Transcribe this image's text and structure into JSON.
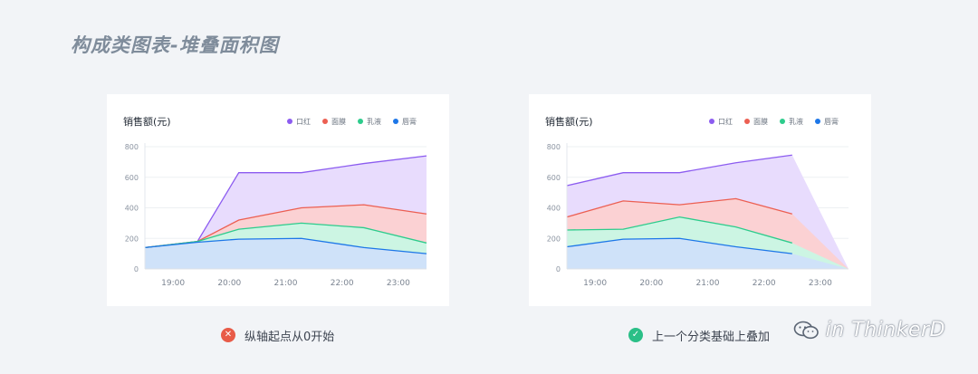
{
  "page": {
    "title": "构成类图表-堆叠面积图",
    "watermark": "in ThinkerD"
  },
  "colors": {
    "background": "#f2f4f7",
    "card": "#ffffff",
    "bad": "#e85b48",
    "good": "#2bbf87"
  },
  "icons": {
    "bad": "close-icon",
    "good": "check-icon",
    "watermark": "wechat-icon"
  },
  "captions": {
    "left": "纵轴起点从0开始",
    "right": "上一个分类基础上叠加"
  },
  "chart_data": [
    {
      "type": "area",
      "title": "销售额(元)",
      "stacked": false,
      "categories": [
        "19:00",
        "20:00",
        "21:00",
        "22:00",
        "23:00"
      ],
      "x_positions": [
        0,
        0.84,
        1.5,
        2.5,
        3.5,
        4.5
      ],
      "yticks": [
        0,
        200,
        400,
        600,
        800
      ],
      "ylim": [
        0,
        800
      ],
      "grid": true,
      "legend_position": "top-right",
      "series": [
        {
          "name": "口红",
          "color": "#8c5cf0",
          "fill": "#e8dcfd",
          "values": [
            140,
            180,
            630,
            630,
            690,
            740
          ]
        },
        {
          "name": "面膜",
          "color": "#ec5f52",
          "fill": "#fbd1d3",
          "values": [
            140,
            180,
            320,
            400,
            420,
            360
          ]
        },
        {
          "name": "乳液",
          "color": "#2dcc8c",
          "fill": "#ccf5e3",
          "values": [
            140,
            180,
            260,
            300,
            270,
            170
          ]
        },
        {
          "name": "唇膏",
          "color": "#1d77e8",
          "fill": "#cfe2f9",
          "values": [
            140,
            175,
            195,
            200,
            140,
            100
          ]
        }
      ]
    },
    {
      "type": "area",
      "title": "销售额(元)",
      "stacked": true,
      "categories": [
        "19:00",
        "20:00",
        "21:00",
        "22:00",
        "23:00"
      ],
      "x_positions": [
        0,
        1,
        2,
        3,
        4,
        5
      ],
      "yticks": [
        0,
        200,
        400,
        600,
        800
      ],
      "ylim": [
        0,
        800
      ],
      "grid": true,
      "legend_position": "top-right",
      "series": [
        {
          "name": "口红",
          "color": "#8c5cf0",
          "fill": "#e8dcfd",
          "values": [
            545,
            630,
            630,
            695,
            745
          ]
        },
        {
          "name": "面膜",
          "color": "#ec5f52",
          "fill": "#fbd1d3",
          "values": [
            340,
            445,
            420,
            460,
            360
          ]
        },
        {
          "name": "乳液",
          "color": "#2dcc8c",
          "fill": "#ccf5e3",
          "values": [
            255,
            260,
            340,
            275,
            170
          ]
        },
        {
          "name": "唇膏",
          "color": "#1d77e8",
          "fill": "#cfe2f9",
          "values": [
            145,
            195,
            200,
            145,
            100
          ]
        }
      ]
    }
  ]
}
